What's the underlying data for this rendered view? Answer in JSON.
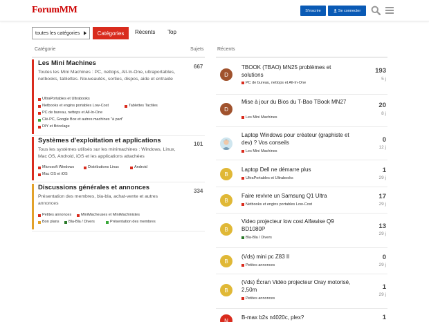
{
  "colors": {
    "brand": "#cc0000",
    "accent_blue": "#0a5ab5",
    "tab_active": "#d92b1d",
    "cat_mini": "#d92b1d",
    "cat_os": "#d92b1d",
    "cat_general": "#e2a12a",
    "sq_red": "#d92b1d",
    "sq_green": "#3aa83a",
    "sq_darkgreen": "#2b7a2b",
    "sq_orange": "#e2a12a",
    "sq_blue": "#1d6bd9"
  },
  "header": {
    "logo": "ForumMM",
    "signup_label": "S'inscrire",
    "login_label": "Se connecter",
    "search_icon": "search-icon",
    "menu_icon": "hamburger-icon"
  },
  "nav": {
    "dropdown_label": "toutes les catégories",
    "tabs": [
      "Catégories",
      "Récents",
      "Top"
    ]
  },
  "columns": {
    "categories": "Catégorie",
    "topics_count": "Sujets",
    "recent": "Récents"
  },
  "categories": [
    {
      "title": "Les Mini Machines",
      "description": "Toutes les Mini Machines : PC, nettops, All-In-One, ultraportables, netbooks, tablettes. Nouveautés, sorties, dispos, aide et entraide",
      "count": "667",
      "subcategories": [
        {
          "name": "UltraPortables et Ultrabooks",
          "color": "#d92b1d"
        },
        {
          "name": "Netbooks et engins portables Low-Cost",
          "color": "#d92b1d"
        },
        {
          "name": "Tablettes Tactiles",
          "color": "#d92b1d"
        },
        {
          "name": "PC de bureau, nettops et All-In-One",
          "color": "#d92b1d"
        },
        {
          "name": "Clé-PC, Google Box et autres machines \"à part\"",
          "color": "#3aa83a"
        },
        {
          "name": "DIY et Bricolage",
          "color": "#d92b1d"
        }
      ]
    },
    {
      "title": "Systèmes d'exploitation et applications",
      "description": "Tous les systèmes utilisés sur les minimachines : Windows, Linux, Mac OS, Android, iOS et les applications attachées",
      "count": "101",
      "subcategories": [
        {
          "name": "Microsoft Windows",
          "color": "#d92b1d"
        },
        {
          "name": "Distributions Linux",
          "color": "#d92b1d"
        },
        {
          "name": "Android",
          "color": "#d92b1d"
        },
        {
          "name": "Mac OS et iOS",
          "color": "#d92b1d"
        }
      ]
    },
    {
      "title": "Discussions générales et annonces",
      "description": "Présentation des membres, bla-bla, achat-vente et autres annonces",
      "count": "334",
      "subcategories": [
        {
          "name": "Petites annonces",
          "color": "#d92b1d"
        },
        {
          "name": "MiniMacheuses et MiniMachinistes",
          "color": "#d92b1d"
        },
        {
          "name": "Bon plans",
          "color": "#e2a12a"
        },
        {
          "name": "Bla-Bla / Divers",
          "color": "#2b7a2b"
        },
        {
          "name": "Présentation des membres",
          "color": "#3aa83a"
        }
      ]
    }
  ],
  "topics": [
    {
      "avatar": "D",
      "avatar_color": "#a0522d",
      "title": "TBOOK (TBAO) MN25 problèmes et solutions",
      "category": "PC de bureau, nettops et All-In-One",
      "cat_color": "#d92b1d",
      "replies": "193",
      "age": "5 j"
    },
    {
      "avatar": "D",
      "avatar_color": "#a0522d",
      "title": "Mise à jour du Bios du T-Bao TBook MN27",
      "category": "Les Mini Machines",
      "cat_color": "#d92b1d",
      "replies": "20",
      "age": "8 j"
    },
    {
      "avatar": "",
      "avatar_color": "#cfe6ef",
      "title": "Laptop Windows pour créateur (graphiste et dev) ? Vos conseils",
      "category": "Les Mini Machines",
      "cat_color": "#d92b1d",
      "replies": "0",
      "age": "12 j"
    },
    {
      "avatar": "B",
      "avatar_color": "#e0b836",
      "title": "Laptop Dell ne démarre plus",
      "category": "UltraPortables et Ultrabooks",
      "cat_color": "#d92b1d",
      "replies": "1",
      "age": "29 j"
    },
    {
      "avatar": "B",
      "avatar_color": "#e0b836",
      "title": "Faire revivre un Samsung Q1 Ultra",
      "category": "Netbooks et engins portables Low-Cost",
      "cat_color": "#d92b1d",
      "replies": "17",
      "age": "29 j"
    },
    {
      "avatar": "B",
      "avatar_color": "#e0b836",
      "title": "Video projecteur low cost Alfawise Q9 BD1080P",
      "category": "Bla-Bla / Divers",
      "cat_color": "#2b7a2b",
      "replies": "13",
      "age": "29 j"
    },
    {
      "avatar": "B",
      "avatar_color": "#e0b836",
      "title": "(Vds) mini pc Z83 II",
      "category": "Petites annonces",
      "cat_color": "#d92b1d",
      "replies": "0",
      "age": "29 j"
    },
    {
      "avatar": "B",
      "avatar_color": "#e0b836",
      "title": "(Vds) Écran Vidéo projecteur Oray motorisé, 2,50m",
      "category": "Petites annonces",
      "cat_color": "#d92b1d",
      "replies": "1",
      "age": "29 j"
    },
    {
      "avatar": "N",
      "avatar_color": "#d92b1d",
      "title": "B-max b2s n4020c, plex?",
      "category": "",
      "cat_color": "#d92b1d",
      "replies": "1",
      "age": ""
    }
  ]
}
